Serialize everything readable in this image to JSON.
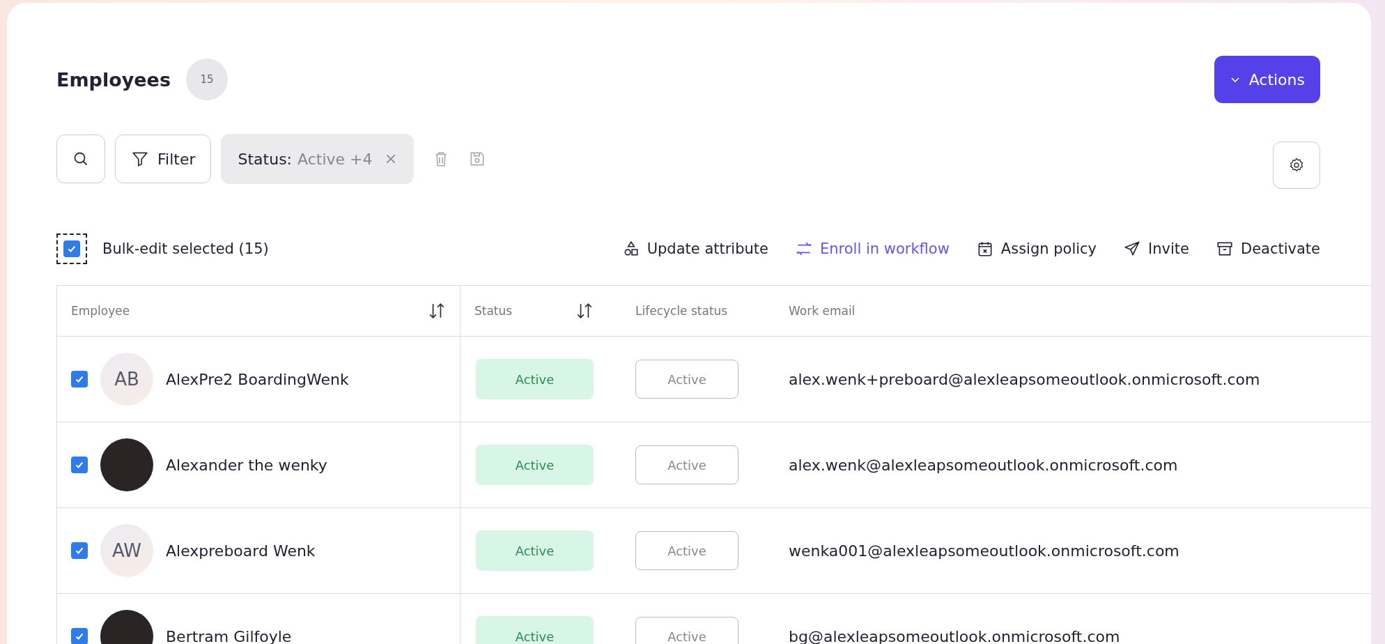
{
  "header": {
    "title": "Employees",
    "count": "15",
    "actions_button": "Actions"
  },
  "filter_bar": {
    "filter_button": "Filter",
    "chip": {
      "key": "Status:",
      "value": "Active +4"
    }
  },
  "bulk_bar": {
    "checked": true,
    "label": "Bulk-edit selected (15)",
    "actions": [
      {
        "label": "Update attribute",
        "kind": "attribute",
        "highlighted": false
      },
      {
        "label": "Enroll in workflow",
        "kind": "workflow",
        "highlighted": true
      },
      {
        "label": "Assign policy",
        "kind": "policy",
        "highlighted": false
      },
      {
        "label": "Invite",
        "kind": "invite",
        "highlighted": false
      },
      {
        "label": "Deactivate",
        "kind": "deactivate",
        "highlighted": false
      }
    ]
  },
  "table": {
    "columns": [
      {
        "label": "Employee",
        "sortable": true
      },
      {
        "label": "Status",
        "sortable": true
      },
      {
        "label": "Lifecycle status",
        "sortable": false
      },
      {
        "label": "Work email",
        "sortable": false
      }
    ],
    "rows": [
      {
        "checked": true,
        "avatar": {
          "kind": "initials",
          "text": "AB"
        },
        "name": "AlexPre2 BoardingWenk",
        "status": "Active",
        "lifecycle_status": "Active",
        "email": "alex.wenk+preboard@alexleapsomeoutlook.onmicrosoft.com"
      },
      {
        "checked": true,
        "avatar": {
          "kind": "photo"
        },
        "name": "Alexander the wenky",
        "status": "Active",
        "lifecycle_status": "Active",
        "email": "alex.wenk@alexleapsomeoutlook.onmicrosoft.com"
      },
      {
        "checked": true,
        "avatar": {
          "kind": "initials",
          "text": "AW"
        },
        "name": "Alexpreboard Wenk",
        "status": "Active",
        "lifecycle_status": "Active",
        "email": "wenka001@alexleapsomeoutlook.onmicrosoft.com"
      },
      {
        "checked": true,
        "avatar": {
          "kind": "photo"
        },
        "name": "Bertram Gilfoyle",
        "status": "Active",
        "lifecycle_status": "Active",
        "email": "bg@alexleapsomeoutlook.onmicrosoft.com"
      }
    ]
  }
}
